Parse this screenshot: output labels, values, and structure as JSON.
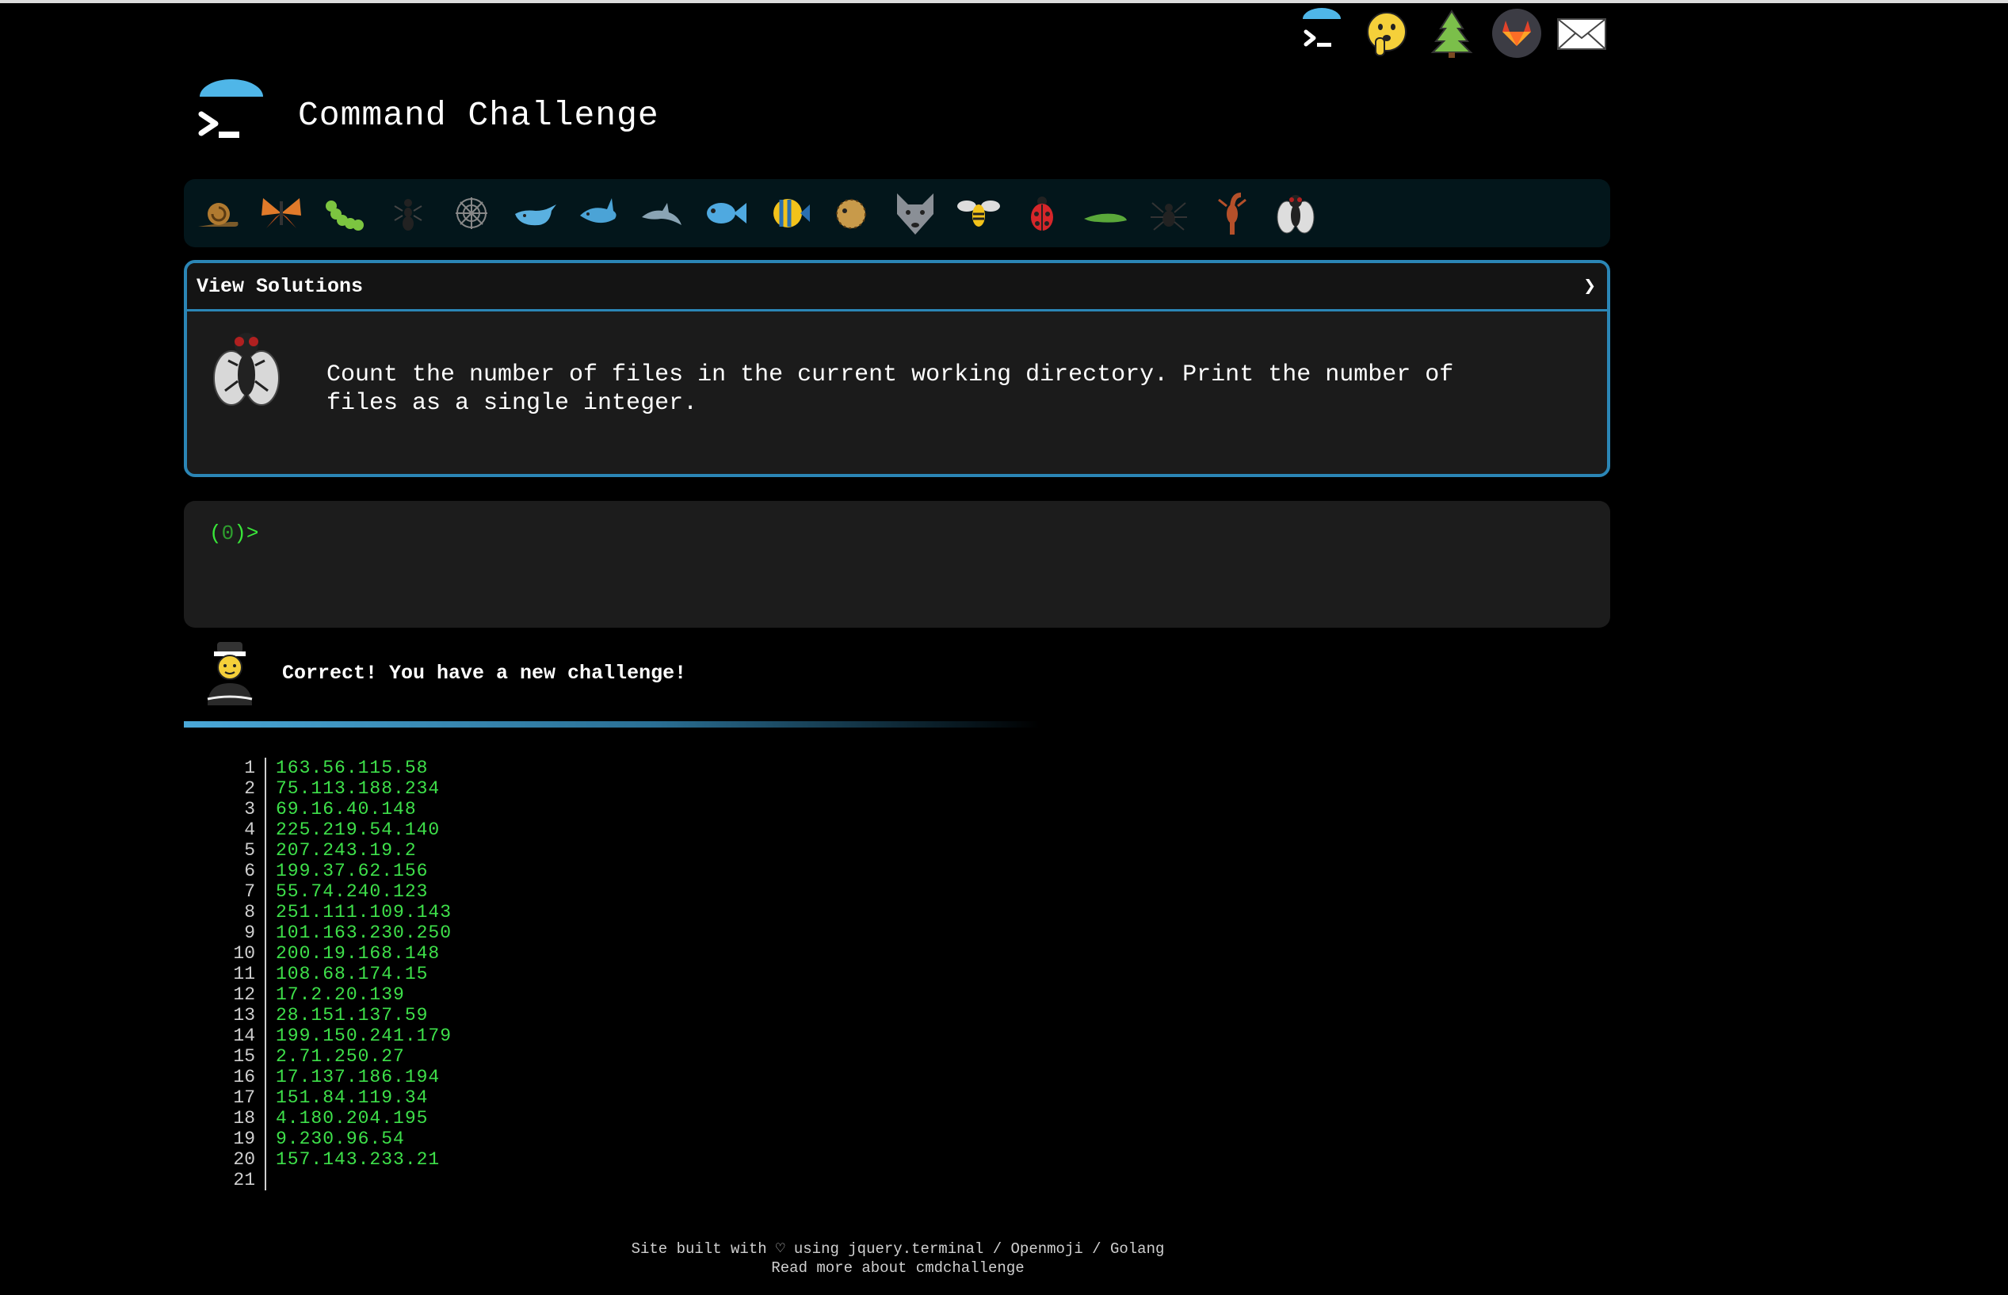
{
  "app": {
    "title": "Command Challenge"
  },
  "top_icons": [
    {
      "name": "terminal-logo-icon"
    },
    {
      "name": "shushing-face-icon"
    },
    {
      "name": "tree-icon"
    },
    {
      "name": "gitlab-icon"
    },
    {
      "name": "mail-icon"
    }
  ],
  "critters": [
    "snail",
    "butterfly",
    "caterpillar",
    "ant",
    "spider-web",
    "whale",
    "shark",
    "dolphin",
    "fish",
    "tropical-fish",
    "blowfish",
    "wolf",
    "bee",
    "ladybug",
    "lizard",
    "spider",
    "scorpion",
    "fly"
  ],
  "challenge": {
    "solutions_label": "View Solutions",
    "arrow": "❯",
    "text": "Count the number of files in the current working directory. Print the number of files as a single integer."
  },
  "terminal": {
    "prompt_open": "(",
    "prompt_count": "0",
    "prompt_close": ")>"
  },
  "message": {
    "text": "Correct! You have a new challenge!"
  },
  "listing": [
    "163.56.115.58",
    "75.113.188.234",
    "69.16.40.148",
    "225.219.54.140",
    "207.243.19.2",
    "199.37.62.156",
    "55.74.240.123",
    "251.111.109.143",
    "101.163.230.250",
    "200.19.168.148",
    "108.68.174.15",
    "17.2.20.139",
    "28.151.137.59",
    "199.150.241.179",
    "2.71.250.27",
    "17.137.186.194",
    "151.84.119.34",
    "4.180.204.195",
    "9.230.96.54",
    "157.143.233.21",
    ""
  ],
  "footer": {
    "line1_prefix": "Site built with ♡ using ",
    "link_jquery": "jquery.terminal",
    "sep1": " / ",
    "link_openmoji": "Openmoji",
    "sep2": " / ",
    "link_golang": "Golang",
    "line2_prefix": "Read more about ",
    "link_about": "cmdchallenge"
  },
  "colors": {
    "accent": "#2b86b6",
    "prompt": "#39e639",
    "output": "#3ee04a"
  }
}
